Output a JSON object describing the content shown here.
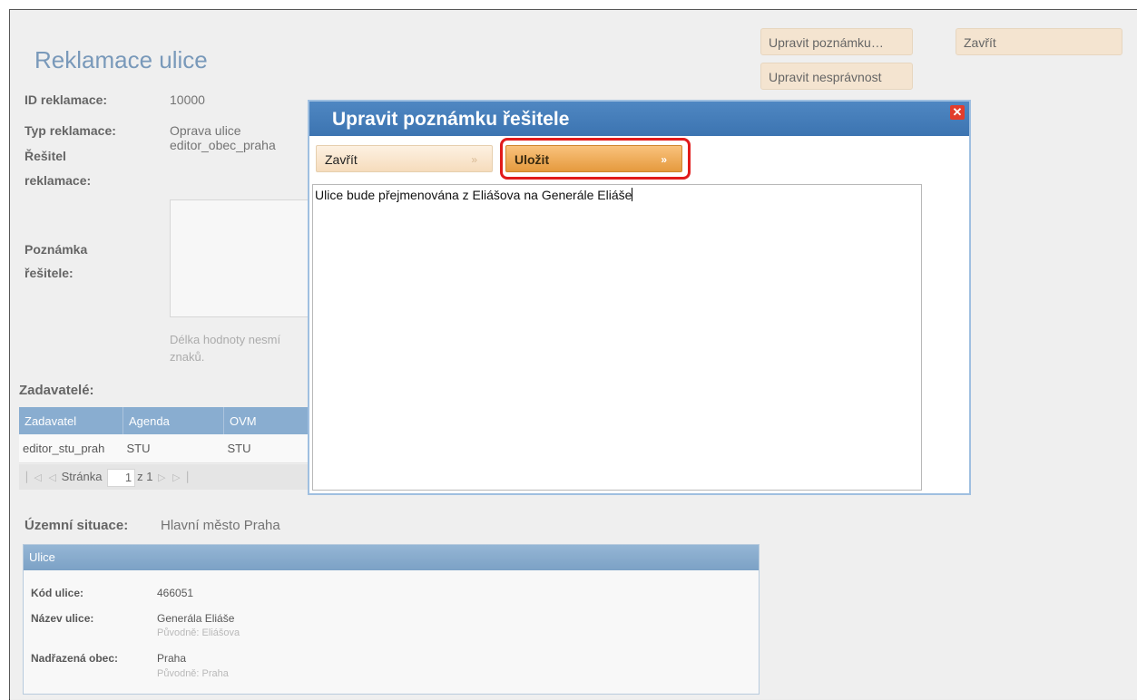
{
  "page": {
    "title": "Reklamace ulice",
    "buttons": {
      "edit_note": "Upravit poznámku…",
      "edit_incorrect": "Upravit nesprávnost",
      "close": "Zavřít"
    },
    "fields": {
      "id_label": "ID reklamace:",
      "id_value": "10000",
      "type_label": "Typ reklamace:",
      "type_value": "Oprava ulice",
      "solver_label_1": "Řešitel",
      "solver_label_2": "reklamace:",
      "solver_value": "editor_obec_praha",
      "note_label_1": "Poznámka",
      "note_label_2": "řešitele:",
      "length_hint_1": "Délka hodnoty nesmí",
      "length_hint_2": "znaků."
    },
    "submitters": {
      "heading": "Zadavatelé:",
      "columns": [
        "Zadavatel",
        "Agenda",
        "OVM"
      ],
      "rows": [
        {
          "zadavatel": "editor_stu_prah",
          "agenda": "STU",
          "ovm": "STU"
        }
      ],
      "pager": {
        "label": "Stránka",
        "current": "1",
        "of": "z 1"
      }
    },
    "territory": {
      "label": "Územní situace:",
      "value": "Hlavní město Praha"
    },
    "street_panel": {
      "title": "Ulice",
      "code_label": "Kód ulice:",
      "code_value": "466051",
      "name_label": "Název ulice:",
      "name_value": "Generála Eliáše",
      "name_original": "Původně: Eliášova",
      "parent_label": "Nadřazená obec:",
      "parent_value": "Praha",
      "parent_original": "Původně: Praha"
    }
  },
  "dialog": {
    "title": "Upravit poznámku řešitele",
    "close_label": "Zavřít",
    "save_label": "Uložit",
    "chevron": "»",
    "text": "Ulice bude přejmenována z Eliášova na Generále Eliáše"
  },
  "colors": {
    "header_blue": "#3c74b1",
    "accent_orange": "#e59a3e",
    "highlight_red": "#e11b1b"
  }
}
